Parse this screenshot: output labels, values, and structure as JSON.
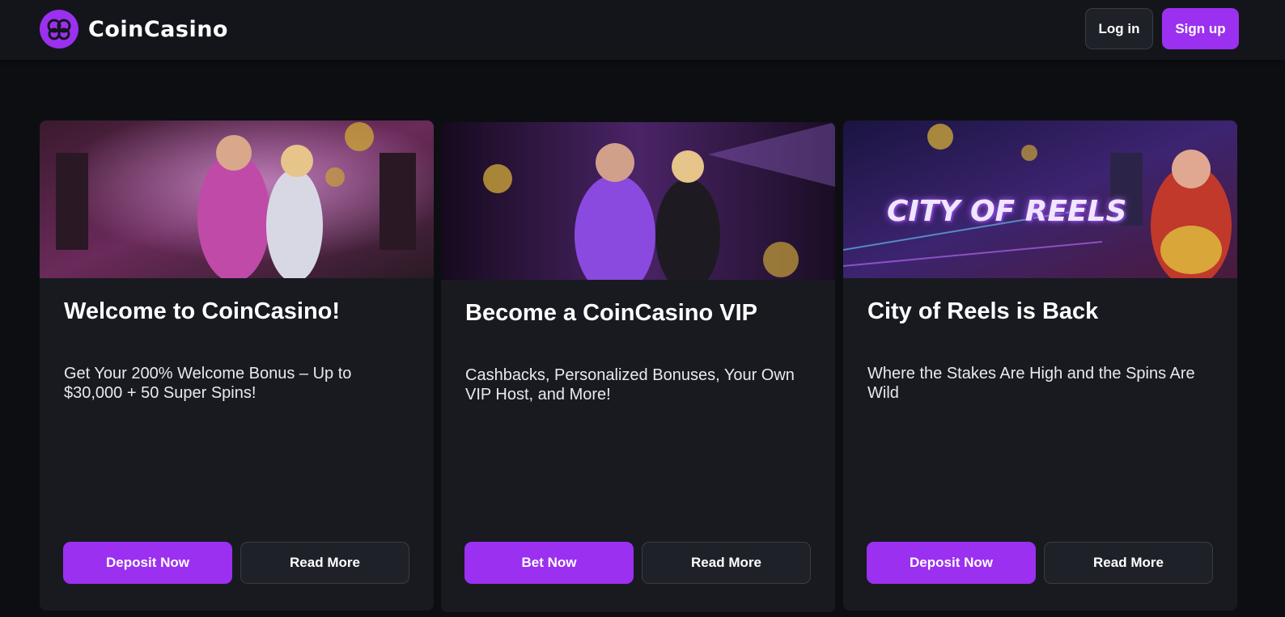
{
  "header": {
    "brand": "CoinCasino",
    "login_label": "Log in",
    "signup_label": "Sign up"
  },
  "colors": {
    "accent": "#9b30f0",
    "background": "#0d0e12",
    "card": "#181a20"
  },
  "promotions": [
    {
      "title": "Welcome to CoinCasino!",
      "description": "Get Your 200% Welcome Bonus – Up to $30,000 + 50 Super Spins!",
      "primary_label": "Deposit Now",
      "secondary_label": "Read More"
    },
    {
      "title": "Become a CoinCasino VIP",
      "description": "Cashbacks, Personalized Bonuses, Your Own VIP Host, and More!",
      "primary_label": "Bet Now",
      "secondary_label": "Read More"
    },
    {
      "title": "City of Reels is Back",
      "description": "Where the Stakes Are High and the Spins Are Wild",
      "primary_label": "Deposit Now",
      "secondary_label": "Read More",
      "banner_text": "CITY OF REELS"
    }
  ]
}
